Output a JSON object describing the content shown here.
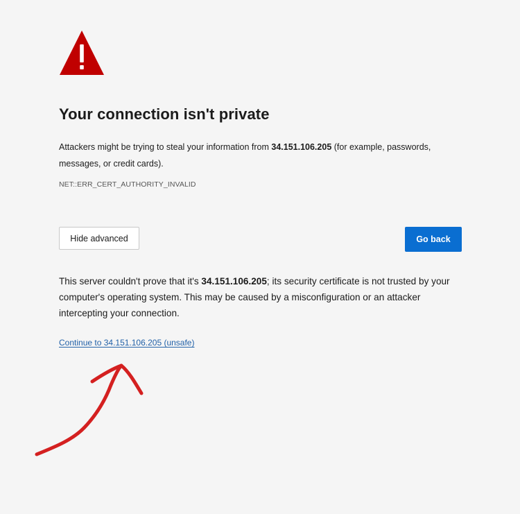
{
  "page": {
    "title": "Your connection isn't private",
    "summary": {
      "before": "Attackers might be trying to steal your information from ",
      "host": "34.151.106.205",
      "after": " (for example, passwords, messages, or credit cards)."
    },
    "error_code": "NET::ERR_CERT_AUTHORITY_INVALID"
  },
  "buttons": {
    "hide_advanced": "Hide advanced",
    "go_back": "Go back"
  },
  "advanced": {
    "before": "This server couldn't prove that it's ",
    "host": "34.151.106.205",
    "after": "; its security certificate is not trusted by your computer's operating system. This may be caused by a misconfiguration or an attacker intercepting your connection.",
    "proceed_link": "Continue to 34.151.106.205 (unsafe)"
  },
  "icons": {
    "warning": "warning-triangle-icon",
    "annotation": "hand-drawn-arrow"
  },
  "colors": {
    "background": "#f5f5f5",
    "warning_red": "#c00000",
    "primary_button": "#0a6ed1",
    "link": "#2161a8",
    "annotation_red": "#d42020"
  }
}
